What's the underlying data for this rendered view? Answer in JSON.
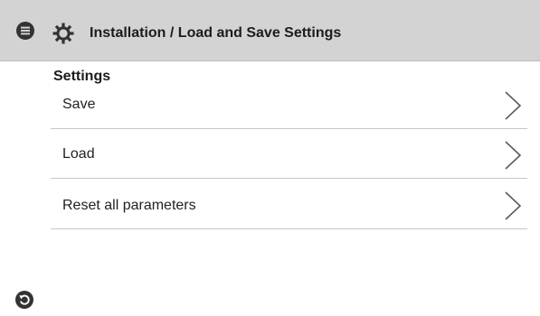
{
  "header": {
    "menu_icon": "menu-icon",
    "settings_icon": "gear-icon",
    "title": "Installation / Load and Save Settings"
  },
  "section": {
    "title": "Settings"
  },
  "items": [
    {
      "label": "Save",
      "icon": "chevron-right-icon"
    },
    {
      "label": "Load",
      "icon": "chevron-right-icon"
    },
    {
      "label": "Reset all parameters",
      "icon": "chevron-right-icon"
    }
  ],
  "footer": {
    "back_icon": "back-icon"
  },
  "colors": {
    "header_bg": "#d3d3d3",
    "icon_fill": "#333333",
    "divider": "#c7c7c7",
    "chevron": "#5a5a5a"
  }
}
